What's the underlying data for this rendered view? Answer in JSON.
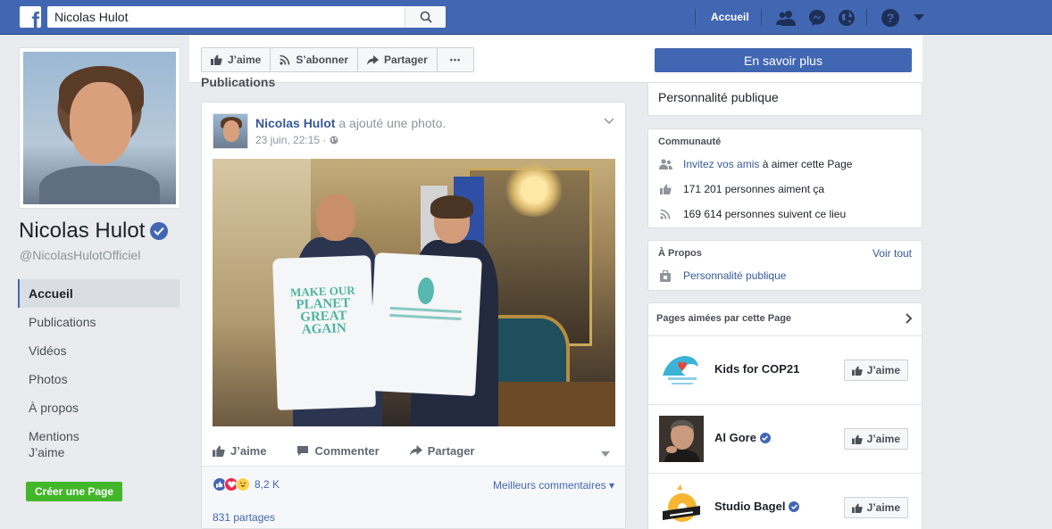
{
  "topbar": {
    "logo": "f",
    "search_value": "Nicolas Hulot",
    "home_label": "Accueil",
    "icons": [
      "search-icon",
      "friends-icon",
      "messenger-icon",
      "globe-icon",
      "help-icon",
      "caret-down-icon"
    ],
    "color": "#4267b2"
  },
  "profile": {
    "name": "Nicolas Hulot",
    "handle": "@NicolasHulotOfficiel"
  },
  "left_nav": {
    "items": [
      {
        "label": "Accueil",
        "active": true
      },
      {
        "label": "Publications"
      },
      {
        "label": "Vidéos"
      },
      {
        "label": "Photos"
      },
      {
        "label": "À propos"
      },
      {
        "label": "Mentions\nJ’aime"
      }
    ],
    "create_page": "Créer une Page"
  },
  "action_bar": {
    "like": "J’aime",
    "subscribe": "S’abonner",
    "share": "Partager",
    "more": "•••",
    "learn_more": "En savoir plus"
  },
  "publications_label": "Publications",
  "post": {
    "author": "Nicolas Hulot",
    "action": " a ajouté une photo.",
    "time": "23 juin, 22:15 · ",
    "shirt_text": [
      "MAKE OUR",
      "PLANET",
      "GREAT",
      "AGAIN"
    ],
    "actions": {
      "like": "J’aime",
      "comment": "Commenter",
      "share": "Partager"
    },
    "reaction_count": "8,2 K",
    "best_comments": "Meilleurs commentaires ▾",
    "shares": "831 partages"
  },
  "right": {
    "top_category": "Personnalité publique",
    "community": {
      "title": "Communauté",
      "invite_link": "Invitez vos amis",
      "invite_rest": " à aimer cette Page",
      "likes": "171 201 personnes aiment ça",
      "follows": "169 614 personnes suivent ce lieu"
    },
    "about": {
      "title": "À Propos",
      "see_all": "Voir tout",
      "category": "Personnalité publique"
    },
    "liked_pages": {
      "title": "Pages aimées par cette Page",
      "like_label": "J’aime",
      "pages": [
        {
          "name": "Kids for COP21",
          "verified": false
        },
        {
          "name": "Al Gore",
          "verified": true
        },
        {
          "name": "Studio Bagel",
          "verified": true
        }
      ]
    }
  }
}
